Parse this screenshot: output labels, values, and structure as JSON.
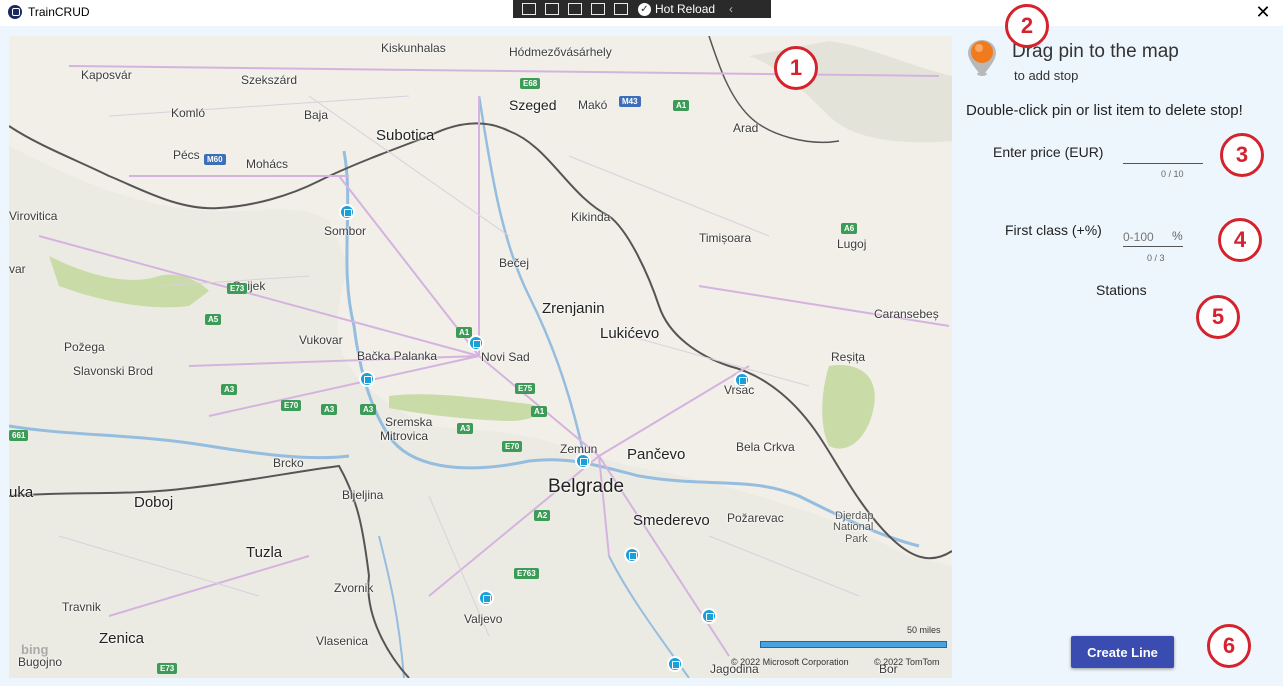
{
  "window": {
    "title": "TrainCRUD",
    "close_glyph": "✕"
  },
  "devbar": {
    "hot_reload": "Hot Reload"
  },
  "map": {
    "cities": [
      {
        "name": "Kiskunhalas",
        "cls": ""
      },
      {
        "name": "Hódmezővásárhely",
        "cls": ""
      },
      {
        "name": "Kaposvár",
        "cls": ""
      },
      {
        "name": "Szekszárd",
        "cls": ""
      },
      {
        "name": "Szeged",
        "cls": "big"
      },
      {
        "name": "Makó",
        "cls": ""
      },
      {
        "name": "Arad",
        "cls": ""
      },
      {
        "name": "Komló",
        "cls": ""
      },
      {
        "name": "Baja",
        "cls": ""
      },
      {
        "name": "Subotica",
        "cls": "big"
      },
      {
        "name": "Pécs",
        "cls": ""
      },
      {
        "name": "Mohács",
        "cls": ""
      },
      {
        "name": "Virovitica",
        "cls": ""
      },
      {
        "name": "Sombor",
        "cls": ""
      },
      {
        "name": "Kikinda",
        "cls": ""
      },
      {
        "name": "Timișoara",
        "cls": ""
      },
      {
        "name": "Lugoj",
        "cls": ""
      },
      {
        "name": "Bečej",
        "cls": ""
      },
      {
        "name": "Osijek",
        "cls": ""
      },
      {
        "name": "Zrenjanin",
        "cls": "big"
      },
      {
        "name": "Lukićevo",
        "cls": "big"
      },
      {
        "name": "Caransebeș",
        "cls": ""
      },
      {
        "name": "Vukovar",
        "cls": ""
      },
      {
        "name": "Požega",
        "cls": ""
      },
      {
        "name": "Bačka Palanka",
        "cls": ""
      },
      {
        "name": "Novi Sad",
        "cls": ""
      },
      {
        "name": "Reșița",
        "cls": ""
      },
      {
        "name": "Slavonski Brod",
        "cls": ""
      },
      {
        "name": "Vršac",
        "cls": ""
      },
      {
        "name": "Sremska",
        "cls": ""
      },
      {
        "name": "Mitrovica",
        "cls": ""
      },
      {
        "name": "Bela Crkva",
        "cls": ""
      },
      {
        "name": "Zemun",
        "cls": ""
      },
      {
        "name": "Pančevo",
        "cls": "big"
      },
      {
        "name": "Brcko",
        "cls": ""
      },
      {
        "name": "Belgrade",
        "cls": "cap"
      },
      {
        "name": "Doboj",
        "cls": "big"
      },
      {
        "name": "Bijeljina",
        "cls": ""
      },
      {
        "name": "Smederevo",
        "cls": "big"
      },
      {
        "name": "Požarevac",
        "cls": ""
      },
      {
        "name": "Djerdap",
        "cls": ""
      },
      {
        "name": "National",
        "cls": ""
      },
      {
        "name": "Park",
        "cls": ""
      },
      {
        "name": "Tuzla",
        "cls": "big"
      },
      {
        "name": "Zvornik",
        "cls": ""
      },
      {
        "name": "Travnik",
        "cls": ""
      },
      {
        "name": "Valjevo",
        "cls": ""
      },
      {
        "name": "Zenica",
        "cls": "big"
      },
      {
        "name": "Vlasenica",
        "cls": ""
      },
      {
        "name": "Bugojno",
        "cls": ""
      },
      {
        "name": "Jagodina",
        "cls": ""
      },
      {
        "name": "Bor",
        "cls": ""
      },
      {
        "name": "uka",
        "cls": "big"
      },
      {
        "name": "var",
        "cls": ""
      }
    ],
    "roads": [
      "E68",
      "M43",
      "A1",
      "M60",
      "A6",
      "E73",
      "A5",
      "A1",
      "E75",
      "A3",
      "E70",
      "A3",
      "A3",
      "A3",
      "A1",
      "E70",
      "A2",
      "E763",
      "E73",
      "661"
    ],
    "scale_label": "50 miles",
    "attribution_ms": "© 2022 Microsoft Corporation",
    "attribution_tt": "© 2022 TomTom",
    "bing": "bing"
  },
  "panel": {
    "title": "Drag pin to the map",
    "subtitle": "to add stop",
    "hint": "Double-click pin or list item to delete stop!",
    "price_label": "Enter price (EUR)",
    "price_value": "",
    "price_counter": "0 / 10",
    "first_class_label": "First class (+%)",
    "first_class_placeholder": "0-100",
    "first_class_unit": "%",
    "first_class_counter": "0 / 3",
    "stations_label": "Stations",
    "create_button": "Create Line"
  },
  "badges": [
    "1",
    "2",
    "3",
    "4",
    "5",
    "6"
  ],
  "colors": {
    "accent": "#3a4cb0",
    "badge": "#d4232d",
    "station": "#1a9fd9"
  }
}
